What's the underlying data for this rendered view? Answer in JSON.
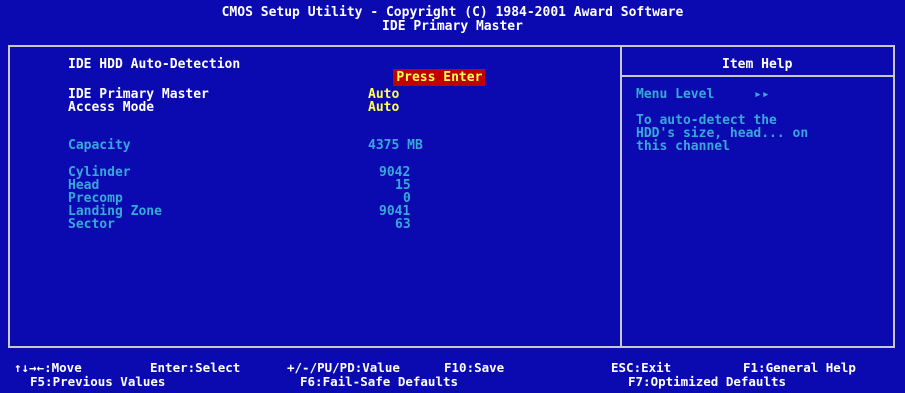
{
  "title": {
    "line1": "CMOS Setup Utility - Copyright (C) 1984-2001 Award Software",
    "line2": "IDE Primary Master"
  },
  "main": {
    "auto_detect": {
      "label": "IDE HDD Auto-Detection",
      "value": "Press Enter"
    },
    "primary_master": {
      "label": "IDE Primary Master",
      "value": "Auto"
    },
    "access_mode": {
      "label": "Access Mode",
      "value": "Auto"
    },
    "capacity": {
      "label": "Capacity",
      "value": "4375 MB"
    },
    "cylinder": {
      "label": "Cylinder",
      "value": "9042"
    },
    "head": {
      "label": "Head",
      "value": "15"
    },
    "precomp": {
      "label": "Precomp",
      "value": "0"
    },
    "landing_zone": {
      "label": "Landing Zone",
      "value": "9041"
    },
    "sector": {
      "label": "Sector",
      "value": "63"
    }
  },
  "help": {
    "title": "Item Help",
    "menu_level_label": "Menu Level",
    "menu_level_value": "▸▸",
    "text_line1": "To auto-detect the",
    "text_line2": "HDD's size, head... on",
    "text_line3": "this channel"
  },
  "footer": {
    "move": "↑↓→←:Move",
    "select": "Enter:Select",
    "value": "+/-/PU/PD:Value",
    "save": "F10:Save",
    "exit": "ESC:Exit",
    "general_help": "F1:General Help",
    "previous": "F5:Previous Values",
    "failsafe": "F6:Fail-Safe Defaults",
    "optimized": "F7:Optimized Defaults"
  }
}
